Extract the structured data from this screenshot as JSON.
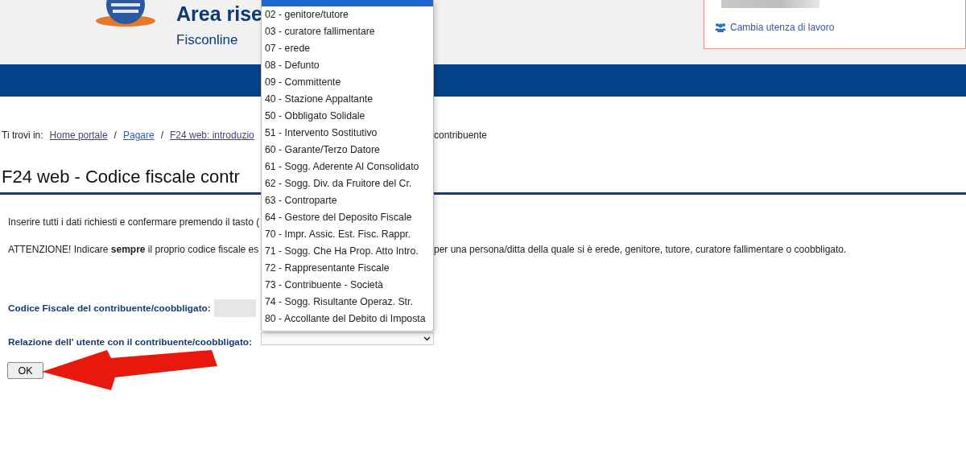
{
  "header": {
    "title": "Area rise",
    "subtitle": "Fisconline",
    "account_link": "Cambia utenza di lavoro"
  },
  "breadcrumb": {
    "prefix": "Ti trovi in:",
    "links": [
      "Home portale",
      "Pagare",
      "F24 web: introduzio"
    ],
    "separator": "/",
    "tail": "contribuente"
  },
  "page_title": "F24 web - Codice fiscale contr",
  "intro": "Inserire tutti i dati richiesti e confermare premendo il tasto (",
  "warning": {
    "left": "ATTENZIONE! Indicare **sempre** il proprio codice fiscale es",
    "right": "per una persona/ditta della quale si è erede, genitore, tutore, curatore fallimentare o coobbligato."
  },
  "form": {
    "fields": [
      {
        "kind": "text",
        "label": "Codice Fiscale del contribuente/coobbligato:"
      },
      {
        "kind": "select",
        "label": "Relazione dell' utente con il contribuente/coobbligato:"
      }
    ],
    "submit": "OK"
  },
  "dropdown": {
    "highlighted_option_cut_off": true,
    "options": [
      {
        "label": "02 - genitore/tutore",
        "selected": false
      },
      {
        "label": "03 - curatore fallimentare",
        "selected": false
      },
      {
        "label": "07 - erede",
        "selected": false
      },
      {
        "label": "08 - Defunto",
        "selected": false
      },
      {
        "label": "09 - Committente",
        "selected": false
      },
      {
        "label": "40 - Stazione Appaltante",
        "selected": false
      },
      {
        "label": "50 - Obbligato Solidale",
        "selected": false
      },
      {
        "label": "51 - Intervento Sostitutivo",
        "selected": false
      },
      {
        "label": "60 - Garante/Terzo Datore",
        "selected": false
      },
      {
        "label": "61 - Sogg. Aderente Al Consolidato",
        "selected": false
      },
      {
        "label": "62 - Sogg. Div. da Fruitore del Cr.",
        "selected": false
      },
      {
        "label": "63 - Controparte",
        "selected": false
      },
      {
        "label": "64 - Gestore del Deposito Fiscale",
        "selected": false
      },
      {
        "label": "70 - Impr. Assic. Est. Fisc. Rappr.",
        "selected": false
      },
      {
        "label": "71 - Sogg. Che Ha Prop. Atto Intro.",
        "selected": false
      },
      {
        "label": "72 - Rappresentante Fiscale",
        "selected": false
      },
      {
        "label": "73 - Contribuente - Società",
        "selected": false
      },
      {
        "label": "74 - Sogg. Risultante Operaz. Str.",
        "selected": false
      },
      {
        "label": "80 - Accollante del Debito di Imposta",
        "selected": false
      }
    ]
  },
  "annotation": {
    "kind": "arrow"
  }
}
